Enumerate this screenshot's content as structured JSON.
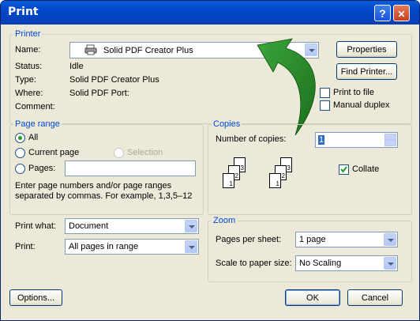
{
  "window": {
    "title": "Print",
    "help_glyph": "?",
    "close_glyph": "✕"
  },
  "printer": {
    "legend": "Printer",
    "name_label": "Name:",
    "name_value": "Solid PDF Creator Plus",
    "status_label": "Status:",
    "status_value": "Idle",
    "type_label": "Type:",
    "type_value": "Solid PDF Creator Plus",
    "where_label": "Where:",
    "where_value": "Solid PDF Port:",
    "comment_label": "Comment:",
    "comment_value": "",
    "properties_button": "Properties",
    "find_printer_button": "Find Printer...",
    "print_to_file_label": "Print to file",
    "print_to_file_checked": false,
    "manual_duplex_label": "Manual duplex",
    "manual_duplex_checked": false
  },
  "page_range": {
    "legend": "Page range",
    "all_label": "All",
    "current_page_label": "Current page",
    "selection_label": "Selection",
    "pages_label": "Pages:",
    "pages_value": "",
    "selected": "All",
    "hint": "Enter page numbers and/or page ranges separated by commas.  For example, 1,3,5–12"
  },
  "copies": {
    "legend": "Copies",
    "number_label": "Number of copies:",
    "number_value": "1",
    "collate_label": "Collate",
    "collate_checked": true,
    "sheets": [
      "3",
      "2",
      "1",
      "3",
      "2",
      "1"
    ]
  },
  "print_what": {
    "label": "Print what:",
    "value": "Document"
  },
  "print": {
    "label": "Print:",
    "value": "All pages in range"
  },
  "zoom": {
    "legend": "Zoom",
    "pages_per_sheet_label": "Pages per sheet:",
    "pages_per_sheet_value": "1 page",
    "scale_label": "Scale to paper size:",
    "scale_value": "No Scaling"
  },
  "buttons": {
    "options": "Options...",
    "ok": "OK",
    "cancel": "Cancel"
  },
  "colors": {
    "accent_arrow": "#2e8b2e",
    "title_bar": "#0047c8",
    "group_label": "#0046d5"
  }
}
